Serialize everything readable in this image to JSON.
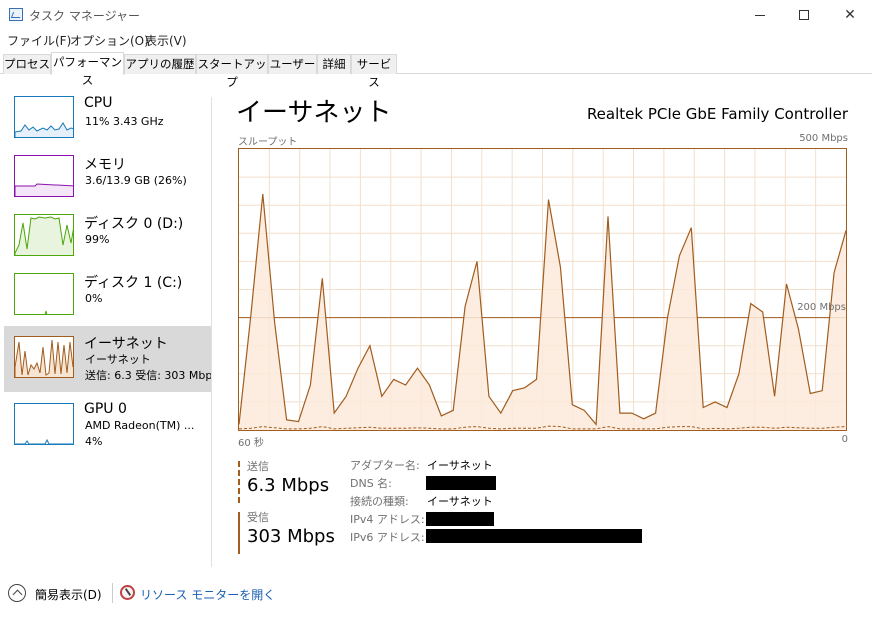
{
  "window": {
    "title": "タスク マネージャー"
  },
  "menu": [
    "ファイル(F)",
    "オプション(O)",
    "表示(V)"
  ],
  "tabs": [
    "プロセス",
    "パフォーマンス",
    "アプリの履歴",
    "スタートアップ",
    "ユーザー",
    "詳細",
    "サービス"
  ],
  "active_tab": 1,
  "sidebar": {
    "items": [
      {
        "title": "CPU",
        "sub1": "11%  3.43 GHz",
        "sub2": "",
        "color": "#1779ba"
      },
      {
        "title": "メモリ",
        "sub1": "3.6/13.9 GB (26%)",
        "sub2": "",
        "color": "#8b12ae"
      },
      {
        "title": "ディスク 0 (D:)",
        "sub1": "99%",
        "sub2": "",
        "color": "#4da60c"
      },
      {
        "title": "ディスク 1 (C:)",
        "sub1": "0%",
        "sub2": "",
        "color": "#4da60c"
      },
      {
        "title": "イーサネット",
        "sub1": "イーサネット",
        "sub2": "送信: 6.3  受信: 303 Mbp",
        "color": "#a15c1e"
      },
      {
        "title": "GPU 0",
        "sub1": "AMD Radeon(TM) ...",
        "sub2": "4%",
        "color": "#1779ba"
      }
    ],
    "selected": 4
  },
  "main": {
    "title": "イーサネット",
    "adapter": "Realtek PCIe GbE Family Controller",
    "throughput_label": "スループット",
    "max_label": "500 Mbps",
    "mid_label": "200 Mbps",
    "x_left": "60 秒",
    "x_right": "0"
  },
  "stats": {
    "send_label": "送信",
    "send_value": "6.3 Mbps",
    "recv_label": "受信",
    "recv_value": "303 Mbps"
  },
  "properties": [
    {
      "label": "アダプター名:",
      "value": "イーサネット",
      "redacted": false
    },
    {
      "label": "DNS 名:",
      "value": "",
      "redacted": true
    },
    {
      "label": "接続の種類:",
      "value": "イーサネット",
      "redacted": false
    },
    {
      "label": "IPv4 アドレス:",
      "value": "",
      "redacted": true
    },
    {
      "label": "IPv6 アドレス:",
      "value": "",
      "redacted": true
    }
  ],
  "footer": {
    "fewer_details": "簡易表示(D)",
    "resource_monitor": "リソース モニターを開く"
  },
  "chart_data": {
    "type": "area",
    "unit": "Mbps",
    "y_top": 500,
    "reference_line": 200,
    "x_seconds": [
      60,
      0
    ],
    "series": [
      {
        "name": "受信",
        "values": [
          10,
          205,
          420,
          190,
          18,
          15,
          80,
          270,
          30,
          60,
          110,
          150,
          60,
          90,
          80,
          110,
          80,
          25,
          35,
          220,
          300,
          60,
          30,
          70,
          75,
          90,
          410,
          290,
          45,
          35,
          10,
          380,
          30,
          30,
          20,
          30,
          200,
          310,
          360,
          40,
          50,
          40,
          100,
          225,
          210,
          60,
          260,
          180,
          65,
          70,
          280,
          355
        ]
      },
      {
        "name": "送信",
        "values": [
          2,
          3,
          6,
          4,
          2,
          2,
          3,
          6,
          2,
          3,
          4,
          5,
          3,
          3,
          3,
          4,
          3,
          2,
          2,
          5,
          6,
          3,
          2,
          3,
          3,
          3,
          7,
          6,
          2,
          2,
          2,
          6,
          2,
          2,
          2,
          2,
          5,
          6,
          6,
          2,
          3,
          2,
          3,
          5,
          5,
          3,
          5,
          4,
          3,
          3,
          5,
          6
        ]
      }
    ]
  }
}
